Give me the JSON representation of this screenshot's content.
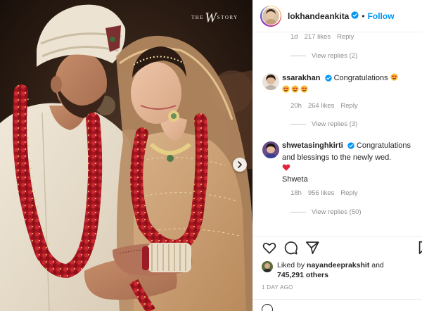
{
  "media": {
    "watermark": {
      "pre": "THE",
      "mark": "W",
      "post": "STORY"
    },
    "next_button_icon": "chevron-right-icon"
  },
  "header": {
    "username": "lokhandeankita",
    "verified_icon": "verified-badge-icon",
    "separator": "•",
    "follow_label": "Follow"
  },
  "comments": {
    "top_partial": {
      "time": "1d",
      "likes": "217 likes",
      "reply": "Reply",
      "view_replies": "View replies (2)"
    },
    "items": [
      {
        "username": "ssarakhan",
        "verified": true,
        "text": "Congratulations",
        "emoji": "heart-eyes-emoji",
        "time": "20h",
        "likes": "264 likes",
        "reply": "Reply",
        "view_replies": "View replies (3)"
      },
      {
        "username": "shwetasinghkirti",
        "verified": true,
        "text_line1": "Congratulations",
        "text_line2": "and blessings to the newly wed.",
        "emoji": "red-heart-emoji",
        "signature": "Shweta",
        "time": "18h",
        "likes": "956 likes",
        "reply": "Reply",
        "view_replies": "View replies (50)"
      }
    ]
  },
  "actions": {
    "like_icon": "heart-outline-icon",
    "comment_icon": "comment-icon",
    "share_icon": "paper-plane-icon",
    "save_icon": "bookmark-icon"
  },
  "likes": {
    "prefix": "Liked by",
    "user": "nayandeeprakshit",
    "conj": "and",
    "count": "745,291 others"
  },
  "timestamp": "1 DAY AGO",
  "colors": {
    "accent": "#0095f6",
    "verified": "#0095f6",
    "muted": "#8e8e8e",
    "text": "#262626",
    "garland": "#b01e2a",
    "turban": "#ece3d2",
    "lehenga": "#c79a6a"
  }
}
